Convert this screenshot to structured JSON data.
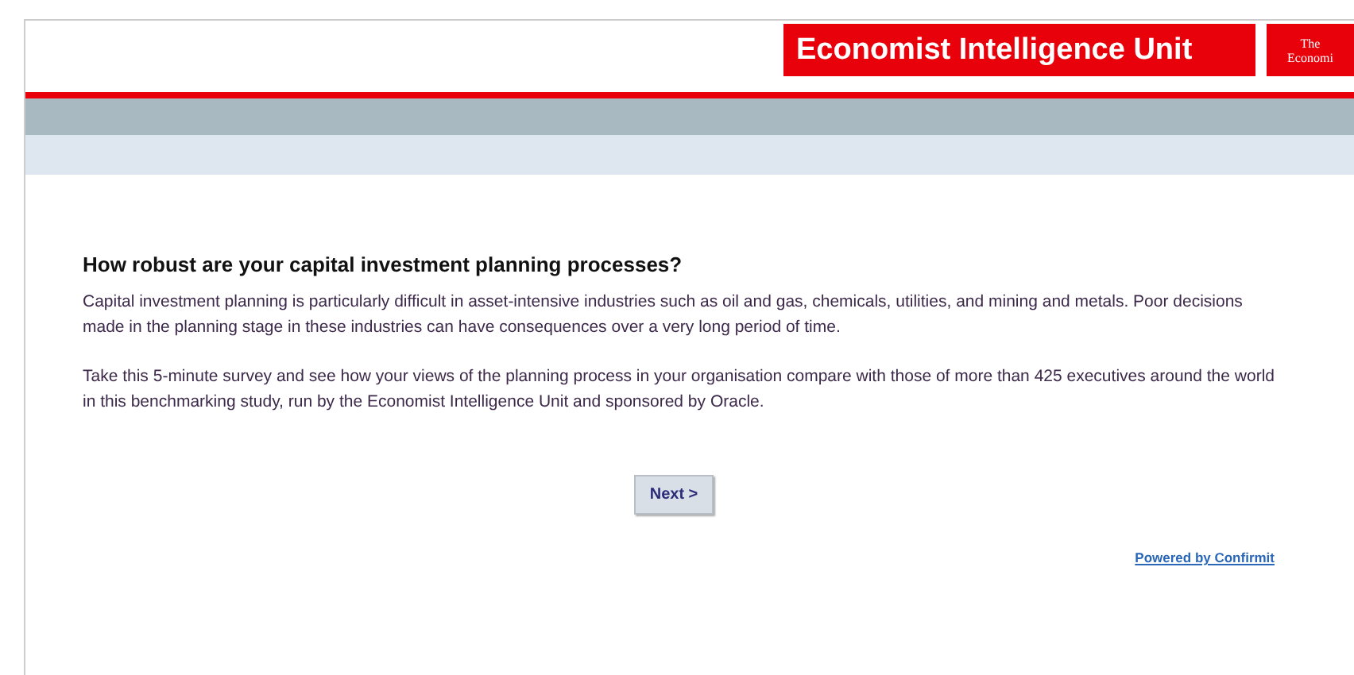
{
  "header": {
    "logo": "Economist Intelligence Unit",
    "secondary_logo": [
      "The",
      "Economi"
    ]
  },
  "survey": {
    "title": "How robust are your capital investment planning processes?",
    "paragraphs": [
      "Capital investment planning is particularly difficult in asset-intensive industries such as oil and gas, chemicals, utilities, and mining and metals. Poor decisions made in the planning stage in these industries can have consequences over a very long period of time.",
      "Take this 5-minute survey and see how your views of the planning process in your organisation compare with those of more than 425 executives around the world in this benchmarking study, run by the Economist Intelligence Unit and sponsored by Oracle."
    ],
    "next_button": "Next >"
  },
  "footer": {
    "link": "Powered by Confirmit"
  }
}
